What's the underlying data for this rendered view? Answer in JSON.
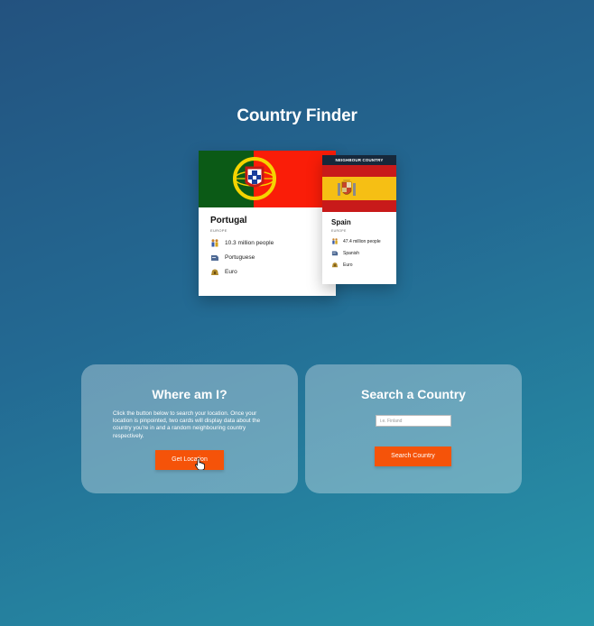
{
  "page": {
    "title": "Country Finder"
  },
  "main_card": {
    "country": "Portugal",
    "region": "EUROPE",
    "population": "10.3 million people",
    "language": "Portuguese",
    "currency": "Euro",
    "flag_colors": {
      "green": "#0b5a16",
      "red": "#fa1d08",
      "gold": "#f5d400"
    }
  },
  "neighbour_card": {
    "banner": "NEIGHBOUR COUNTRY",
    "country": "Spain",
    "region": "EUROPE",
    "population": "47.4 million people",
    "language": "Spanish",
    "currency": "Euro",
    "flag_colors": {
      "red": "#c81a1a",
      "yellow": "#f6bf14"
    }
  },
  "where_panel": {
    "title": "Where am I?",
    "description": "Click the button below to search your location. Once your location is pinpointed, two cards will display data about the country you're in and a random neighbouring country respectively.",
    "button_label": "Get Location"
  },
  "search_panel": {
    "title": "Search a Country",
    "input_placeholder": "i.e. Finland",
    "input_value": "",
    "button_label": "Search Country"
  },
  "colors": {
    "accent": "#f55309",
    "banner": "#17283a"
  },
  "icons": [
    "population-icon",
    "language-icon",
    "currency-icon",
    "pointer-cursor-icon"
  ]
}
